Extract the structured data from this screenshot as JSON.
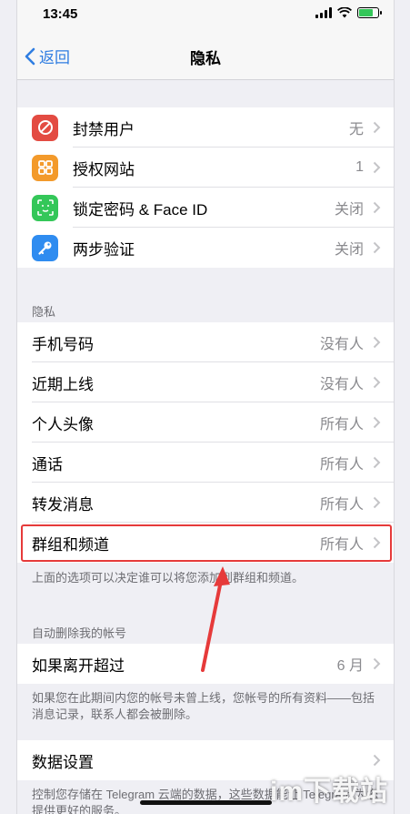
{
  "status_bar": {
    "time": "13:45"
  },
  "nav": {
    "back_label": "返回",
    "title": "隐私"
  },
  "security_items": [
    {
      "label": "封禁用户",
      "value": "无"
    },
    {
      "label": "授权网站",
      "value": "1"
    },
    {
      "label": "锁定密码 & Face ID",
      "value": "关闭"
    },
    {
      "label": "两步验证",
      "value": "关闭"
    }
  ],
  "privacy_section": {
    "header": "隐私",
    "items": [
      {
        "label": "手机号码",
        "value": "没有人"
      },
      {
        "label": "近期上线",
        "value": "没有人"
      },
      {
        "label": "个人头像",
        "value": "所有人"
      },
      {
        "label": "通话",
        "value": "所有人"
      },
      {
        "label": "转发消息",
        "value": "所有人"
      },
      {
        "label": "群组和频道",
        "value": "所有人"
      }
    ],
    "footer": "上面的选项可以决定谁可以将您添加到群组和频道。"
  },
  "auto_delete_section": {
    "header": "自动删除我的帐号",
    "item": {
      "label": "如果离开超过",
      "value": "6 月"
    },
    "footer": "如果您在此期间内您的帐号未曾上线，您帐号的所有资料——包括消息记录，联系人都会被删除。"
  },
  "data_section": {
    "item": {
      "label": "数据设置",
      "value": ""
    },
    "footer": "控制您存储在 Telegram 云端的数据，这些数据能让 Telegram 为您提供更好的服务。"
  },
  "watermark": "im下载站",
  "colors": {
    "accent": "#2f7de1",
    "highlight": "#e63a3a",
    "blocked_icon": "#e34b42",
    "websites_icon": "#f39a2b",
    "passcode_icon": "#34c759",
    "twostep_icon": "#2f8cf0"
  }
}
